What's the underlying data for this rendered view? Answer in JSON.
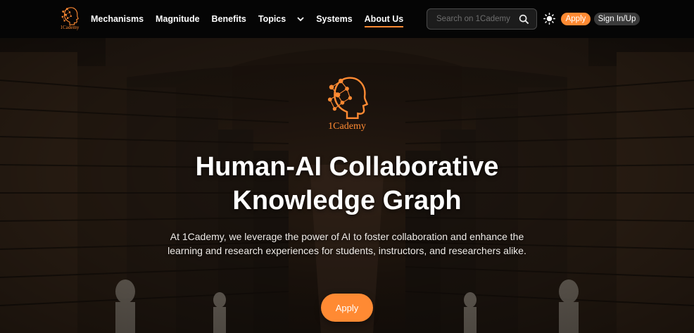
{
  "brand": {
    "name": "1Cademy",
    "accent": "#ff8a33",
    "logo_icon": "head-network-logo-icon"
  },
  "nav": {
    "links": [
      "Mechanisms",
      "Magnitude",
      "Benefits",
      "Topics",
      "Systems",
      "About Us"
    ],
    "active": "About Us",
    "topics_dropdown_icon": "chevron-down-icon"
  },
  "search": {
    "placeholder": "Search on 1Cademy",
    "value": "",
    "icon": "search-icon"
  },
  "theme_toggle_icon": "sun-icon",
  "header_buttons": {
    "apply_label": "Apply",
    "signin_label": "Sign In/Up"
  },
  "hero": {
    "title_line1": "Human-AI Collaborative",
    "title_line2": "Knowledge Graph",
    "subtitle_line1": "At 1Cademy, we leverage the power of AI to foster collaboration and enhance the",
    "subtitle_line2": "learning and research experiences for students, instructors, and researchers alike.",
    "apply_label": "Apply"
  }
}
